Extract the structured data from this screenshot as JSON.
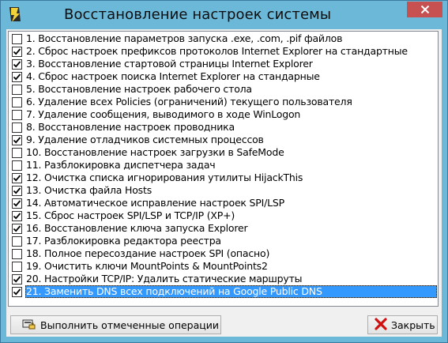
{
  "window": {
    "title": "Восстановление настроек системы"
  },
  "icons": {
    "app": "app-icon",
    "close": "close-icon",
    "check": "check-icon",
    "run": "run-icon",
    "cancel": "cancel-x-icon"
  },
  "colors": {
    "titlebar": "#6cb8d8",
    "close_button": "#c75050",
    "selection": "#3399ff"
  },
  "items": [
    {
      "label": "1. Восстановление параметров запуска .exe, .com, .pif файлов",
      "checked": false
    },
    {
      "label": "2. Сброс настроек префиксов протоколов Internet Explorer на стандартные",
      "checked": true
    },
    {
      "label": "3. Восстановление стартовой страницы Internet Explorer",
      "checked": true
    },
    {
      "label": "4. Сброс настроек поиска Internet Explorer на стандарные",
      "checked": true
    },
    {
      "label": "5. Восстановление настроек рабочего стола",
      "checked": false
    },
    {
      "label": "6. Удаление всех Policies (ограничений) текущего пользователя",
      "checked": false
    },
    {
      "label": "7. Удаление сообщения, выводимого в ходе WinLogon",
      "checked": false
    },
    {
      "label": "8. Восстановление настроек проводника",
      "checked": false
    },
    {
      "label": "9. Удаление отладчиков системных процессов",
      "checked": true
    },
    {
      "label": "10. Восстановление настроек загрузки в SafeMode",
      "checked": false
    },
    {
      "label": "11. Разблокировка диспетчера задач",
      "checked": false
    },
    {
      "label": "12. Очистка списка игнорирования утилиты HijackThis",
      "checked": true
    },
    {
      "label": "13. Очистка файла Hosts",
      "checked": true
    },
    {
      "label": "14. Автоматическое исправление настроек SPI/LSP",
      "checked": true
    },
    {
      "label": "15. Сброс настроек SPI/LSP и TCP/IP (XP+)",
      "checked": true
    },
    {
      "label": "16. Восстановление ключа запуска Explorer",
      "checked": true
    },
    {
      "label": "17. Разблокировка редактора реестра",
      "checked": false
    },
    {
      "label": "18. Полное пересоздание настроек SPI (опасно)",
      "checked": false
    },
    {
      "label": "19. Очистить ключи MountPoints & MountPoints2",
      "checked": false
    },
    {
      "label": "20. Настройки TCP/IP: Удалить статические маршруты",
      "checked": true
    },
    {
      "label": "21. Заменить DNS всех подключений на Google Public DNS",
      "checked": true,
      "selected": true
    }
  ],
  "buttons": {
    "run": "Выполнить отмеченные операции",
    "close": "Закрыть"
  }
}
